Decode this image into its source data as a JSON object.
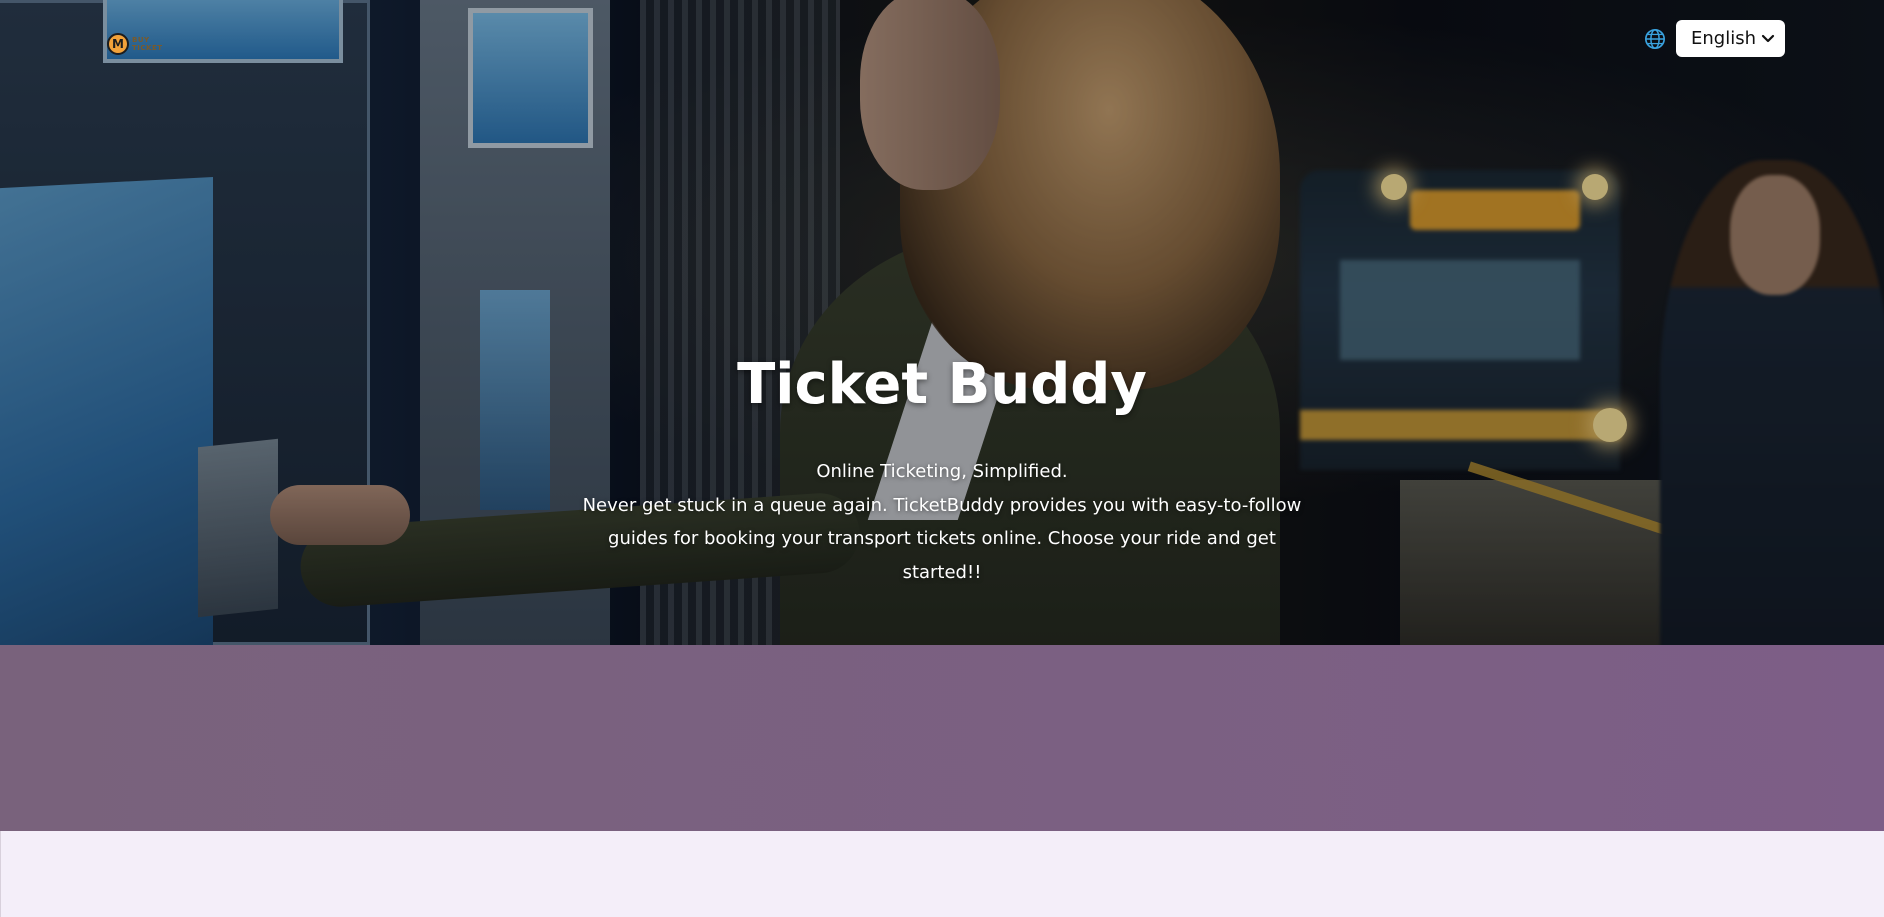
{
  "header": {
    "logo": {
      "mark": "M",
      "text_lines": [
        "BUY",
        "TICKET"
      ]
    },
    "language": {
      "icon": "globe-icon",
      "selected": "English"
    }
  },
  "hero": {
    "title": "Ticket Buddy",
    "tagline": "Online Ticketing, Simplified.",
    "description": "Never get stuck in a queue again. TicketBuddy provides you with easy-to-follow guides for booking your transport tickets online. Choose your ride and get started!!"
  },
  "colors": {
    "band": "#7b6082",
    "page_background": "#f4eef9",
    "logo_accent": "#f2a23a",
    "globe_icon": "#3aa3e0"
  }
}
